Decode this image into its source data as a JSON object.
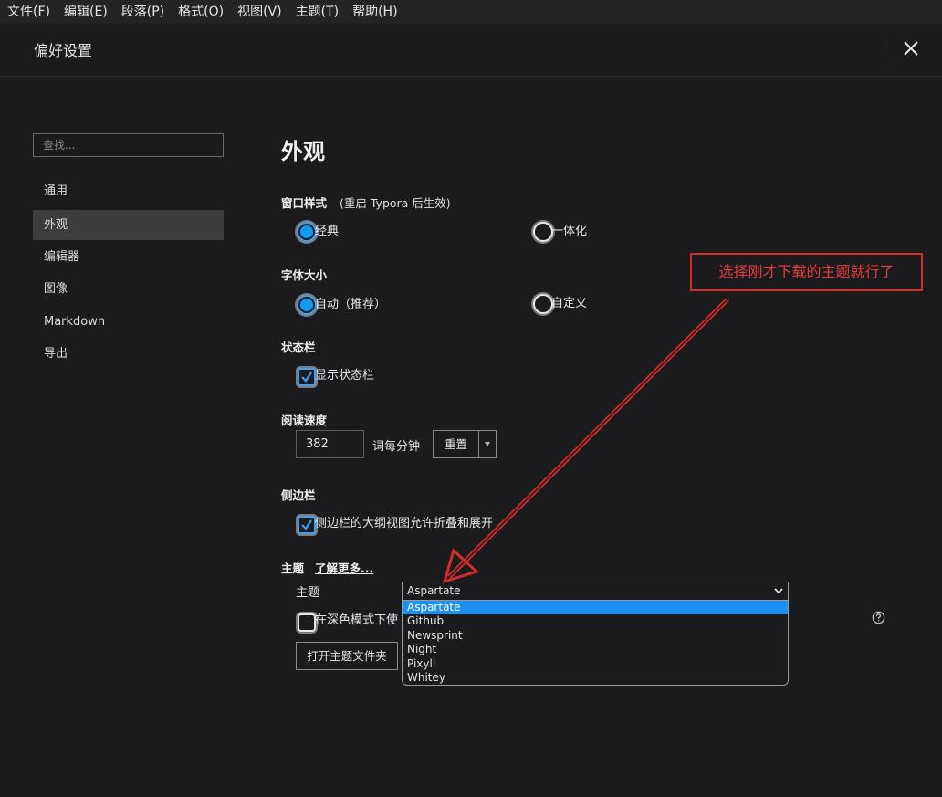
{
  "menubar": {
    "items": [
      "文件(F)",
      "编辑(E)",
      "段落(P)",
      "格式(O)",
      "视图(V)",
      "主题(T)",
      "帮助(H)"
    ]
  },
  "header": {
    "title": "偏好设置",
    "close_icon": "close-icon"
  },
  "sidebar": {
    "search_placeholder": "查找...",
    "items": [
      {
        "label": "通用",
        "active": false
      },
      {
        "label": "外观",
        "active": true
      },
      {
        "label": "编辑器",
        "active": false
      },
      {
        "label": "图像",
        "active": false
      },
      {
        "label": "Markdown",
        "active": false
      },
      {
        "label": "导出",
        "active": false
      }
    ]
  },
  "main": {
    "title": "外观",
    "window_style": {
      "label": "窗口样式",
      "note": "(重启 Typora 后生效)",
      "options": [
        {
          "label": "经典",
          "selected": true
        },
        {
          "label": "一体化",
          "selected": false
        }
      ]
    },
    "font_size": {
      "label": "字体大小",
      "options": [
        {
          "label": "自动（推荐）",
          "selected": true
        },
        {
          "label": "自定义",
          "selected": false
        }
      ]
    },
    "status_bar": {
      "label": "状态栏",
      "checkbox": {
        "label": "显示状态栏",
        "checked": true
      }
    },
    "reading_speed": {
      "label": "阅读速度",
      "value": "382",
      "unit": "词每分钟",
      "reset_label": "重置"
    },
    "sidebar_section": {
      "label": "侧边栏",
      "checkbox": {
        "label": "侧边栏的大纲视图允许折叠和展开",
        "checked": true
      }
    },
    "theme": {
      "label": "主题",
      "learn_more": "了解更多...",
      "field_label": "主题",
      "selected": "Aspartate",
      "options": [
        "Aspartate",
        "Github",
        "Newsprint",
        "Night",
        "Pixyll",
        "Whitey"
      ],
      "dark_mode_checkbox": {
        "label": "在深色模式下使",
        "checked": false
      },
      "open_folder_label": "打开主题文件夹",
      "help_icon": "help-circle-icon"
    }
  },
  "annotation": {
    "text": "选择刚才下载的主题就行了",
    "color": "#e33b3b"
  },
  "colors": {
    "accent": "#0f9bf0",
    "selection": "#1f8ff2",
    "background": "#1b1b1d"
  }
}
